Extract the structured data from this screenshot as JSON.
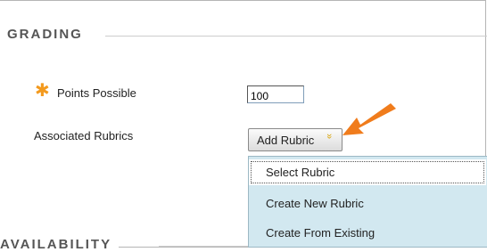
{
  "grading": {
    "header": "GRADING",
    "points_possible_label": "Points Possible",
    "points_possible_value": "100",
    "required_marker": "✱",
    "associated_rubrics_label": "Associated Rubrics",
    "add_rubric_label": "Add Rubric"
  },
  "rubric_menu": {
    "items": [
      {
        "label": "Select Rubric",
        "selected": true
      },
      {
        "label": "Create New Rubric"
      },
      {
        "label": "Create From Existing"
      }
    ]
  },
  "availability": {
    "header": "AVAILABILITY"
  },
  "colors": {
    "required_star": "#f39a1e",
    "annotation_arrow": "#f07c1c",
    "menu_background": "#d2e8f0"
  }
}
